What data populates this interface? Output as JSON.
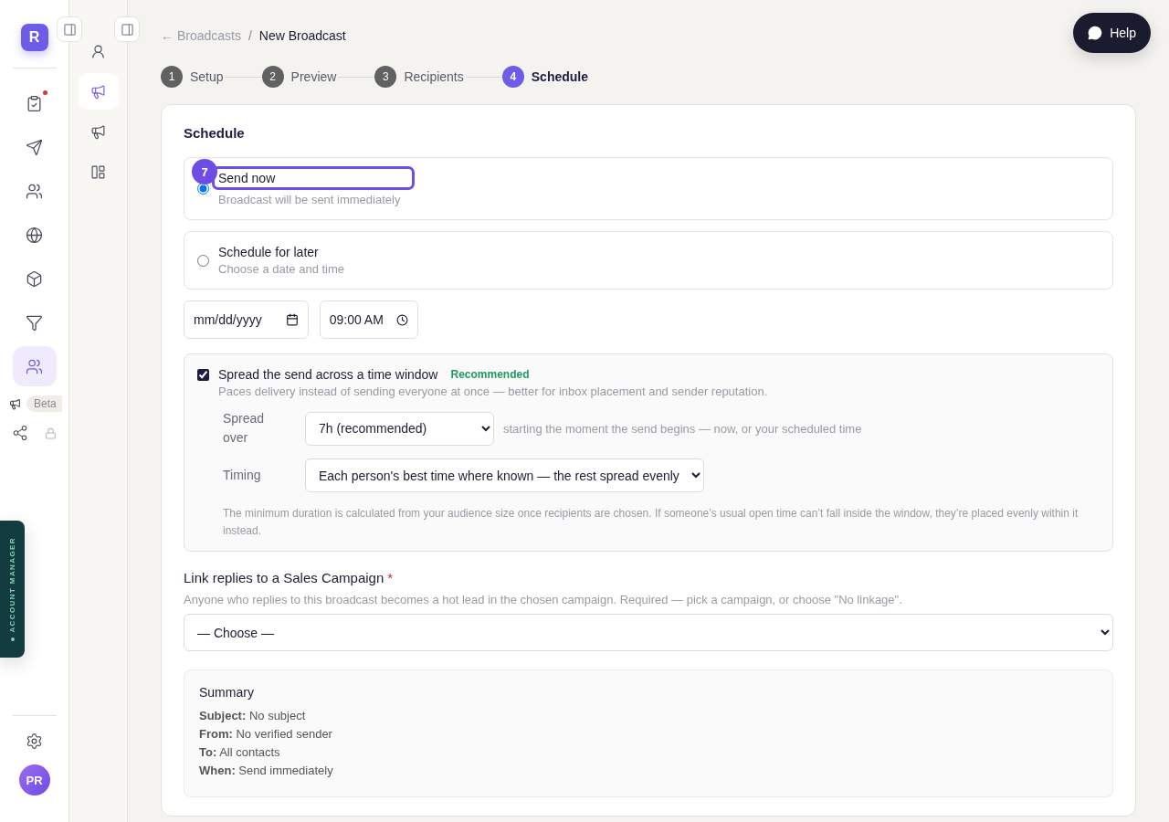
{
  "rail": {
    "logo": "R",
    "items": [
      {
        "kind": "clipboard",
        "selected": false,
        "notification": true
      },
      {
        "kind": "send",
        "selected": false,
        "notification": false
      },
      {
        "kind": "contacts",
        "selected": false,
        "notification": false
      },
      {
        "kind": "globe",
        "selected": false,
        "notification": false
      },
      {
        "kind": "box",
        "selected": false,
        "notification": false
      },
      {
        "kind": "filter",
        "selected": false,
        "notification": false
      },
      {
        "kind": "users",
        "selected": true,
        "notification": false
      }
    ],
    "beta_label": "Beta",
    "account_manager": "ACCOUNT MANAGER",
    "avatar": "PR"
  },
  "subnav": {
    "items": [
      {
        "kind": "user",
        "selected": false
      },
      {
        "kind": "megaphone",
        "selected": true
      },
      {
        "kind": "megaphone",
        "selected": false
      },
      {
        "kind": "layout",
        "selected": false
      }
    ]
  },
  "breadcrumb": {
    "back": "← Broadcasts",
    "separator": "/",
    "current": "New Broadcast"
  },
  "help_button": "Help",
  "steps": [
    {
      "number": "1",
      "label": "Setup",
      "selected": false
    },
    {
      "number": "2",
      "label": "Preview",
      "selected": false
    },
    {
      "number": "3",
      "label": "Recipients",
      "selected": false
    },
    {
      "number": "4",
      "label": "Schedule",
      "selected": true
    }
  ],
  "schedule": {
    "title": "Schedule",
    "annotation": "7",
    "options": [
      {
        "title": "Send now",
        "description": "Broadcast will be sent immediately",
        "selected": true
      },
      {
        "title": "Schedule for later",
        "description": "Choose a date and time",
        "selected": false
      }
    ],
    "date_placeholder": "mm/dd/yyyy",
    "time_value": "09:00 AM",
    "spread": {
      "checked": true,
      "title": "Spread the send across a time window",
      "tag": "Recommended",
      "description": "Paces delivery instead of sending everyone at once — better for inbox placement and sender reputation.",
      "spread_label": "Spread over",
      "spread_value": "7h (recommended)",
      "spread_hint": "starting the moment the send begins — now, or your scheduled time",
      "timing_label": "Timing",
      "timing_value": "Each person's best time where known — the rest spread evenly",
      "note": "The minimum duration is calculated from your audience size once recipients are chosen. If someone’s usual open time can’t fall inside the window, they’re placed evenly within it instead."
    },
    "campaign": {
      "label": "Link replies to a Sales Campaign",
      "required": "*",
      "description": "Anyone who replies to this broadcast becomes a hot lead in the chosen campaign. Required — pick a campaign, or choose \"No linkage\".",
      "value": "— Choose —"
    },
    "summary": {
      "title": "Summary",
      "lines": [
        "**Subject:** No subject",
        "**From:** No verified sender",
        "**To:** All contacts",
        "**When:** Send immediately"
      ]
    }
  }
}
